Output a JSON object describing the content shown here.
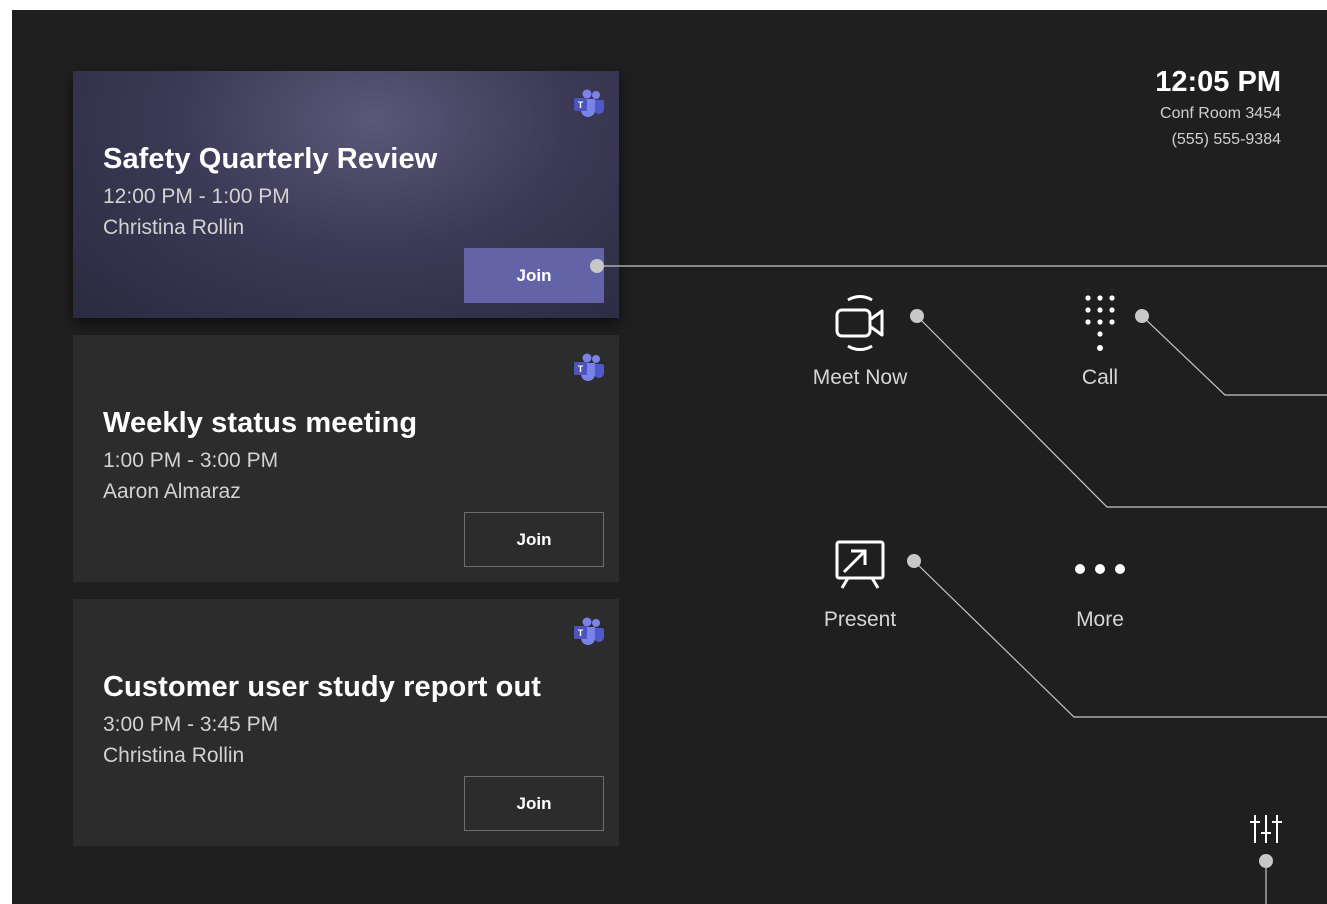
{
  "status": {
    "time": "12:05 PM",
    "room": "Conf Room 3454",
    "phone": "(555) 555-9384"
  },
  "meetings": [
    {
      "title": "Safety Quarterly Review",
      "time": "12:00 PM - 1:00 PM",
      "organizer": "Christina Rollin",
      "join_label": "Join",
      "active": true
    },
    {
      "title": "Weekly status meeting",
      "time": "1:00 PM - 3:00 PM",
      "organizer": "Aaron Almaraz",
      "join_label": "Join",
      "active": false
    },
    {
      "title": "Customer user study report out",
      "time": "3:00 PM - 3:45 PM",
      "organizer": "Christina Rollin",
      "join_label": "Join",
      "active": false
    }
  ],
  "actions": {
    "meet_now": {
      "label": "Meet Now",
      "icon": "video-camera-icon"
    },
    "call": {
      "label": "Call",
      "icon": "dialpad-icon"
    },
    "present": {
      "label": "Present",
      "icon": "present-screen-icon"
    },
    "more": {
      "label": "More",
      "icon": "more-dots-icon"
    }
  },
  "settings": {
    "icon": "sliders-icon"
  },
  "colors": {
    "background": "#201f1f",
    "card": "#2d2c2c",
    "accent": "#6264a7",
    "callout": "#c8c8c8"
  }
}
